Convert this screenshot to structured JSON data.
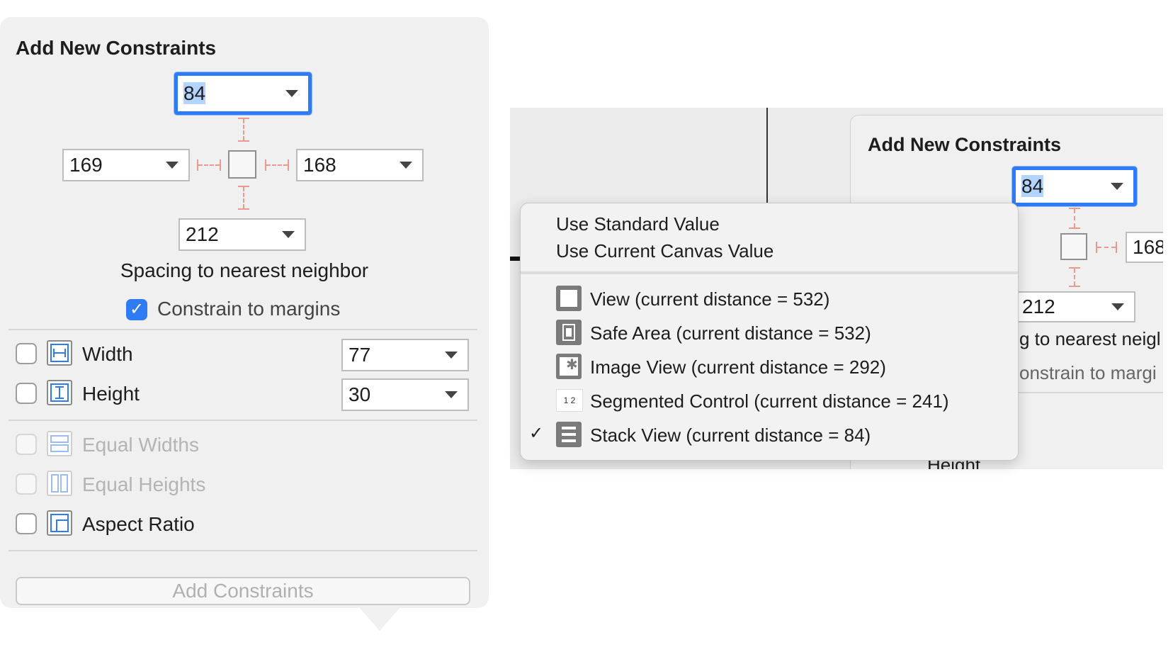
{
  "left_popover": {
    "title": "Add New Constraints",
    "top_value": "84",
    "left_value": "169",
    "right_value": "168",
    "bottom_value": "212",
    "spacing_label": "Spacing to nearest neighbor",
    "constrain_margins_label": "Constrain to margins",
    "constrain_margins_checked": true,
    "width_label": "Width",
    "width_value": "77",
    "height_label": "Height",
    "height_value": "30",
    "equal_widths_label": "Equal Widths",
    "equal_heights_label": "Equal Heights",
    "aspect_ratio_label": "Aspect Ratio",
    "add_button_label": "Add Constraints",
    "check_mark": "✓"
  },
  "right_popover": {
    "title": "Add New Constraints",
    "top_value": "84",
    "right_value": "168",
    "bottom_value": "212",
    "spacing_label_partial": "g to nearest neigl",
    "constrain_partial": "onstrain to margi",
    "height_partial": "Height"
  },
  "dropdown_menu": {
    "standard_value": "Use Standard Value",
    "canvas_value": "Use Current Canvas Value",
    "items": [
      {
        "label": "View (current distance = 532)",
        "icon": "view-icon",
        "checked": false
      },
      {
        "label": "Safe Area (current distance = 532)",
        "icon": "safe-area-icon",
        "checked": false
      },
      {
        "label": "Image View (current distance = 292)",
        "icon": "image-view-icon",
        "checked": false
      },
      {
        "label": "Segmented Control (current distance = 241)",
        "icon": "segmented-control-icon",
        "checked": false
      },
      {
        "label": "Stack View (current distance = 84)",
        "icon": "stack-view-icon",
        "checked": true
      }
    ],
    "check_mark": "✓",
    "segmented_glyph": "1 2"
  },
  "colors": {
    "accent": "#2f7bf5",
    "strut": "#e89a90",
    "panel": "#f0f0f0"
  }
}
